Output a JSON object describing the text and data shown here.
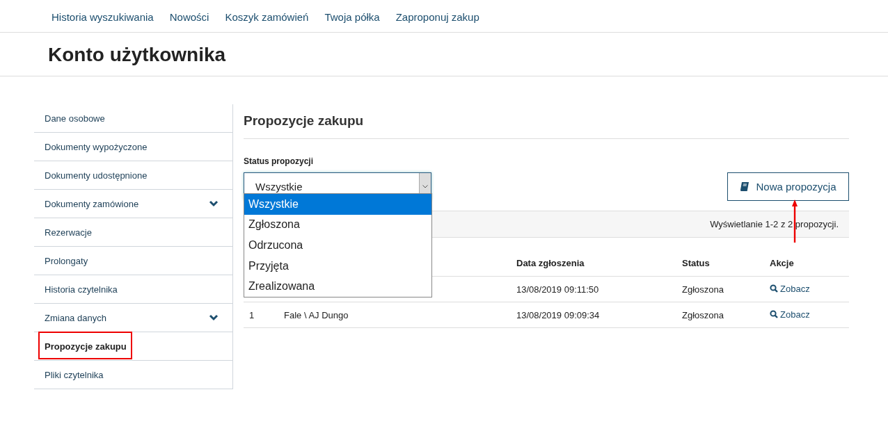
{
  "top_nav": [
    "Historia wyszukiwania",
    "Nowości",
    "Koszyk zamówień",
    "Twoja półka",
    "Zaproponuj zakup"
  ],
  "page_title": "Konto użytkownika",
  "sidebar": {
    "items": [
      {
        "label": "Dane osobowe",
        "selected": false,
        "expandable": false
      },
      {
        "label": "Dokumenty wypożyczone",
        "selected": false,
        "expandable": false
      },
      {
        "label": "Dokumenty udostępnione",
        "selected": false,
        "expandable": false
      },
      {
        "label": "Dokumenty zamówione",
        "selected": false,
        "expandable": true
      },
      {
        "label": "Rezerwacje",
        "selected": false,
        "expandable": false
      },
      {
        "label": "Prolongaty",
        "selected": false,
        "expandable": false
      },
      {
        "label": "Historia czytelnika",
        "selected": false,
        "expandable": false
      },
      {
        "label": "Zmiana danych",
        "selected": false,
        "expandable": true
      },
      {
        "label": "Propozycje zakupu",
        "selected": true,
        "expandable": false
      },
      {
        "label": "Pliki czytelnika",
        "selected": false,
        "expandable": false
      }
    ]
  },
  "section_title": "Propozycje zakupu",
  "status_filter": {
    "label": "Status propozycji",
    "value": "Wszystkie",
    "expanded": true,
    "options": [
      {
        "label": "Wszystkie",
        "selected": true
      },
      {
        "label": "Zgłoszona",
        "selected": false
      },
      {
        "label": "Odrzucona",
        "selected": false
      },
      {
        "label": "Przyjęta",
        "selected": false
      },
      {
        "label": "Zrealizowana",
        "selected": false
      }
    ]
  },
  "new_button": "Nowa propozycja",
  "summary": "Wyświetlanie 1-2 z 2 propozycji.",
  "table": {
    "columns": [
      "",
      "",
      "Data zgłoszenia",
      "Status",
      "Akcje"
    ],
    "rows": [
      {
        "column_1": "",
        "column_2": "",
        "date": "13/08/2019 09:11:50",
        "status": "Zgłoszona",
        "action": "Zobacz"
      },
      {
        "column_1": "1",
        "column_2": "Fale \\ AJ Dungo",
        "date": "13/08/2019 09:09:34",
        "status": "Zgłoszona",
        "action": "Zobacz"
      }
    ]
  }
}
